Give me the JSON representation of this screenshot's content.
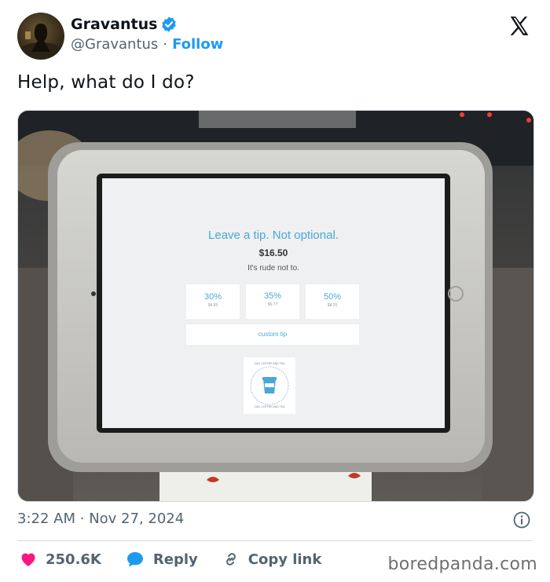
{
  "author": {
    "name": "Gravantus",
    "handle": "@Gravantus",
    "separator": "·",
    "follow_label": "Follow",
    "verified_color": "#1d9bf0"
  },
  "tweet": {
    "text": "Help, what do I do?",
    "time": "3:22 AM",
    "separator": "·",
    "date": "Nov 27, 2024"
  },
  "photo": {
    "screen": {
      "title": "Leave a tip. Not optional.",
      "amount": "$16.50",
      "subtitle": "It's rude not to.",
      "options": [
        {
          "percent": "30%",
          "amount": "$4.95"
        },
        {
          "percent": "35%",
          "amount": "$5.77"
        },
        {
          "percent": "50%",
          "amount": "$8.25"
        }
      ],
      "custom_tip_label": "custom tip",
      "logo_text_top": "CALI COFFEE AND TEA",
      "logo_text_bottom": "CALI COFFEE AND TEA"
    }
  },
  "actions": {
    "likes": "250.6K",
    "reply_label": "Reply",
    "copy_link_label": "Copy link"
  },
  "watermark": "boredpanda.com",
  "colors": {
    "like": "#f91880",
    "reply": "#1d9bf0",
    "link_icon": "#536471",
    "screen_accent": "#4aa8d8"
  }
}
